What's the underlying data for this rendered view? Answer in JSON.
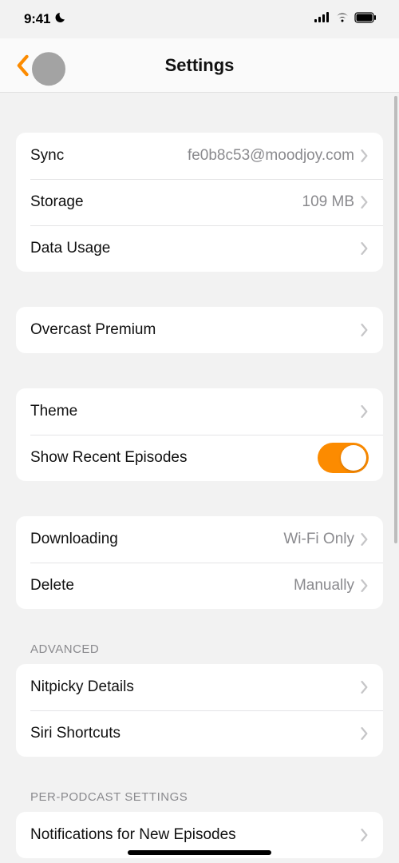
{
  "status": {
    "time": "9:41"
  },
  "nav": {
    "title": "Settings"
  },
  "sections": {
    "account": {
      "sync": {
        "label": "Sync",
        "value": "fe0b8c53@moodjoy.com"
      },
      "storage": {
        "label": "Storage",
        "value": "109 MB"
      },
      "data_usage": {
        "label": "Data Usage"
      }
    },
    "premium": {
      "label": "Overcast Premium"
    },
    "display": {
      "theme": {
        "label": "Theme"
      },
      "recent": {
        "label": "Show Recent Episodes",
        "enabled": true
      }
    },
    "downloads": {
      "downloading": {
        "label": "Downloading",
        "value": "Wi-Fi Only"
      },
      "delete": {
        "label": "Delete",
        "value": "Manually"
      }
    },
    "advanced": {
      "header": "ADVANCED",
      "nitpicky": {
        "label": "Nitpicky Details"
      },
      "siri": {
        "label": "Siri Shortcuts"
      }
    },
    "per_podcast": {
      "header": "PER-PODCAST SETTINGS",
      "notifications": {
        "label": "Notifications for New Episodes"
      }
    }
  }
}
